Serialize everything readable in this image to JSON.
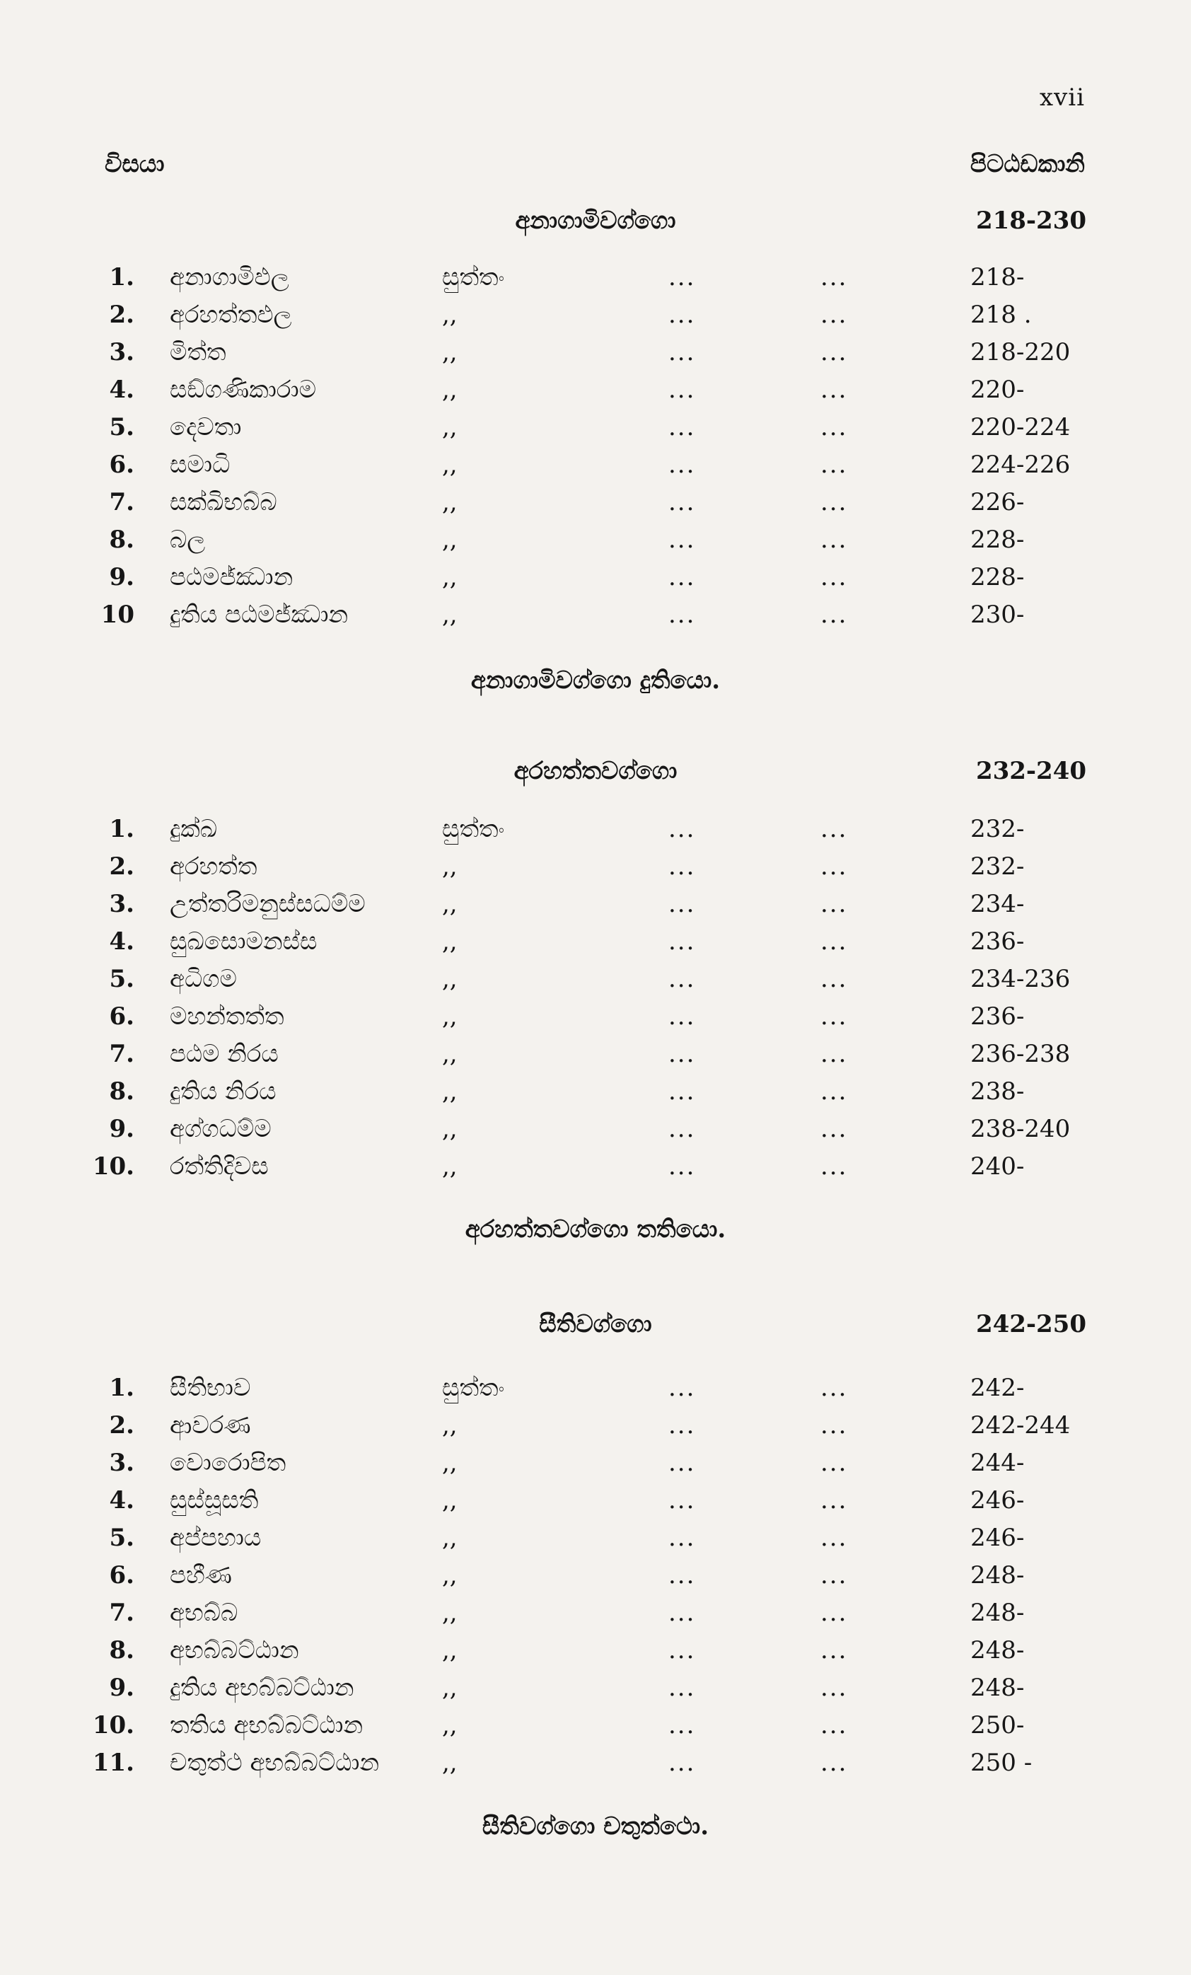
{
  "folio": "xvii",
  "header": {
    "left": "විසයා",
    "right": "පිටඨඩකානි"
  },
  "sections": [
    {
      "title": "අනාගාමිවග්ගො",
      "range": "218-230",
      "rows": [
        {
          "num": "1.",
          "title": "අනාගාමිඵල",
          "sutta": "සුත්තං",
          "pages": "218-"
        },
        {
          "num": "2.",
          "title": "අරහත්තඵල",
          "sutta": ",,",
          "pages": "218 ."
        },
        {
          "num": "3.",
          "title": "මිත්ත",
          "sutta": ",,",
          "pages": "218-220"
        },
        {
          "num": "4.",
          "title": "සඞ්ගණිකාරාම",
          "sutta": ",,",
          "pages": "220-"
        },
        {
          "num": "5.",
          "title": "දෙවතා",
          "sutta": ",,",
          "pages": "220-224"
        },
        {
          "num": "6.",
          "title": "සමාධි",
          "sutta": ",,",
          "pages": "224-226"
        },
        {
          "num": "7.",
          "title": "සක්ඛිභබ්බ",
          "sutta": ",,",
          "pages": "226-"
        },
        {
          "num": "8.",
          "title": "බල",
          "sutta": ",,",
          "pages": "228-"
        },
        {
          "num": "9.",
          "title": "පඨමජ්ඣාන",
          "sutta": ",,",
          "pages": "228-"
        },
        {
          "num": "10",
          "title": "දුතිය පඨමජ්ඣාන",
          "sutta": ",,",
          "pages": "230-"
        }
      ],
      "closing": "අනාගාමිවග්ගො දුතියො."
    },
    {
      "title": "අරහත්තවග්ගො",
      "range": "232-240",
      "rows": [
        {
          "num": "1.",
          "title": "දුක්ඛ",
          "sutta": "සුත්තං",
          "pages": "232-"
        },
        {
          "num": "2.",
          "title": "අරහත්ත",
          "sutta": ",,",
          "pages": "232-"
        },
        {
          "num": "3.",
          "title": "උත්තරිමනුස්සධම්ම",
          "sutta": ",,",
          "pages": "234-"
        },
        {
          "num": "4.",
          "title": "සුඛසොමනස්ස",
          "sutta": ",,",
          "pages": "236-"
        },
        {
          "num": "5.",
          "title": "අධිගම",
          "sutta": ",,",
          "pages": "234-236"
        },
        {
          "num": "6.",
          "title": "මහන්තත්ත",
          "sutta": ",,",
          "pages": "236-"
        },
        {
          "num": "7.",
          "title": "පඨම නිරය",
          "sutta": ",,",
          "pages": "236-238"
        },
        {
          "num": "8.",
          "title": "දුතිය නිරය",
          "sutta": ",,",
          "pages": "238-"
        },
        {
          "num": "9.",
          "title": "අග්ගධම්ම",
          "sutta": ",,",
          "pages": "238-240"
        },
        {
          "num": "10.",
          "title": "රත්තිදිවස",
          "sutta": ",,",
          "pages": "240-"
        }
      ],
      "closing": "අරහත්තවග්ගො තතියො."
    },
    {
      "title": "සීතිවග්ගො",
      "range": "242-250",
      "rows": [
        {
          "num": "1.",
          "title": "සීතිභාව",
          "sutta": "සුත්තං",
          "pages": "242-"
        },
        {
          "num": "2.",
          "title": "ආවරණ",
          "sutta": ",,",
          "pages": "242-244"
        },
        {
          "num": "3.",
          "title": "වොරොපිත",
          "sutta": ",,",
          "pages": "244-"
        },
        {
          "num": "4.",
          "title": "සුස්සූසති",
          "sutta": ",,",
          "pages": "246-"
        },
        {
          "num": "5.",
          "title": "අප්පහාය",
          "sutta": ",,",
          "pages": "246-"
        },
        {
          "num": "6.",
          "title": "පහීණ",
          "sutta": ",,",
          "pages": "248-"
        },
        {
          "num": "7.",
          "title": "අභබ්බ",
          "sutta": ",,",
          "pages": "248-"
        },
        {
          "num": "8.",
          "title": "අභබ්බට්ඨාන",
          "sutta": ",,",
          "pages": "248-"
        },
        {
          "num": "9.",
          "title": "දුතිය අභබ්බට්ඨාන",
          "sutta": ",,",
          "pages": "248-"
        },
        {
          "num": "10.",
          "title": "තතිය අභබ්බට්ඨාන",
          "sutta": ",,",
          "pages": "250-"
        },
        {
          "num": "11.",
          "title": "චතුත්ථ අභබ්බට්ඨාන",
          "sutta": ",,",
          "pages": "250 -"
        }
      ],
      "closing": "සීතිවග්ගො චතුත්ථො."
    }
  ],
  "dots": "..."
}
